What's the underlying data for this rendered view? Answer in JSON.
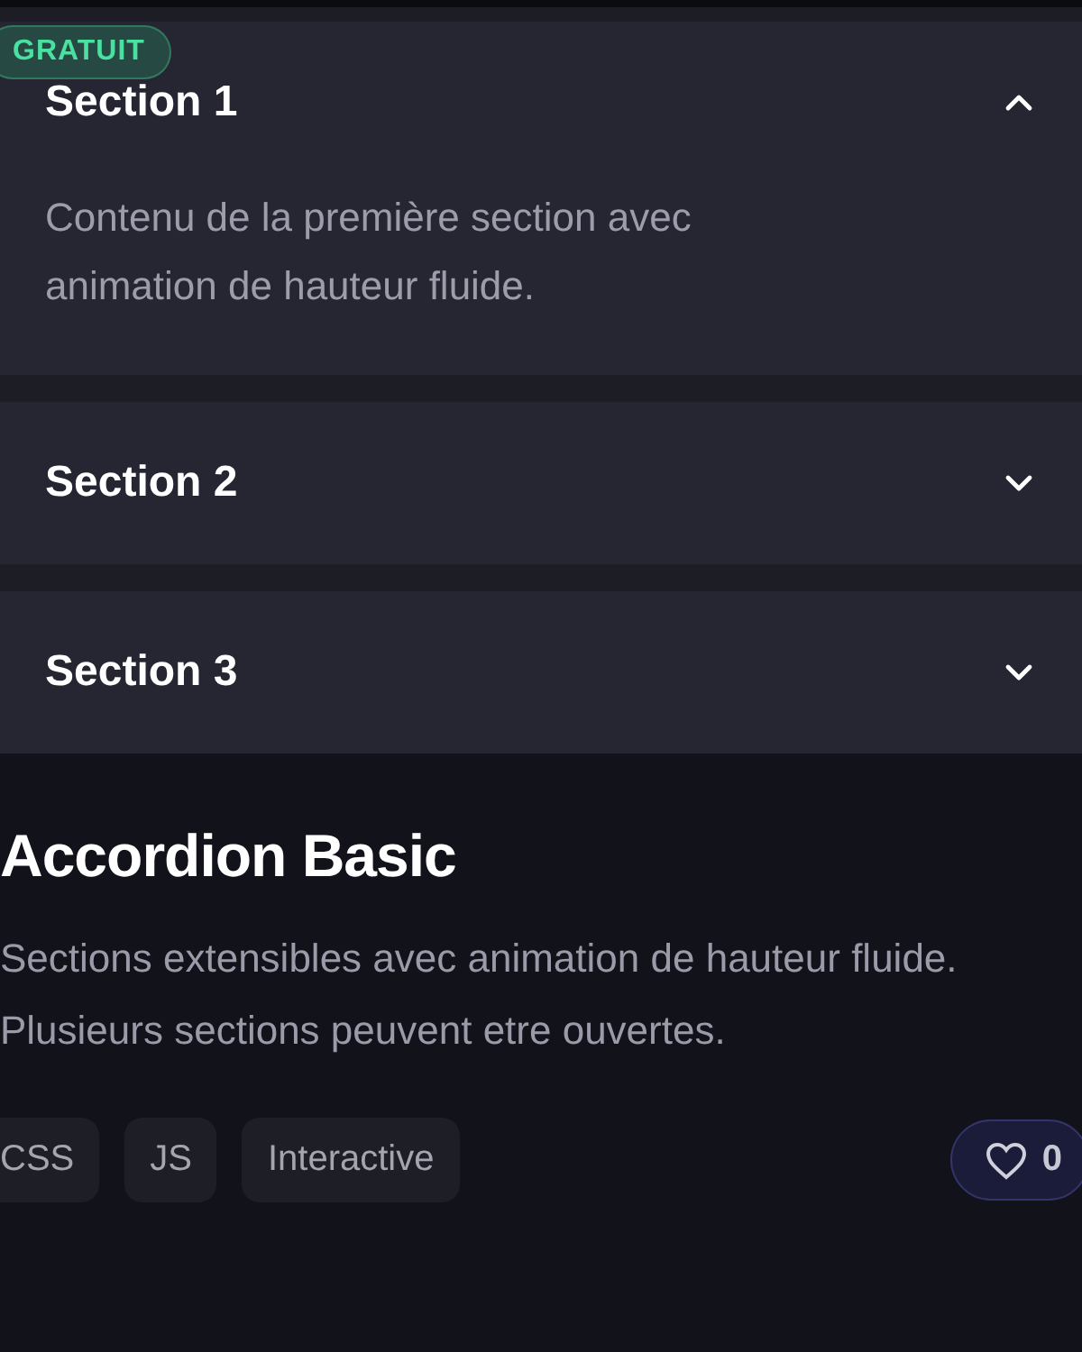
{
  "badge": "GRATUIT",
  "accordion": [
    {
      "title": "Section 1",
      "expanded": true,
      "content": "Contenu de la première section avec animation de hauteur fluide."
    },
    {
      "title": "Section 2",
      "expanded": false
    },
    {
      "title": "Section 3",
      "expanded": false
    }
  ],
  "title": "Accordion Basic",
  "description": "Sections extensibles avec animation de hauteur fluide. Plusieurs sections peuvent etre ouvertes.",
  "tags": [
    "CSS",
    "JS",
    "Interactive"
  ],
  "likes": {
    "count": "0",
    "liked": false
  }
}
